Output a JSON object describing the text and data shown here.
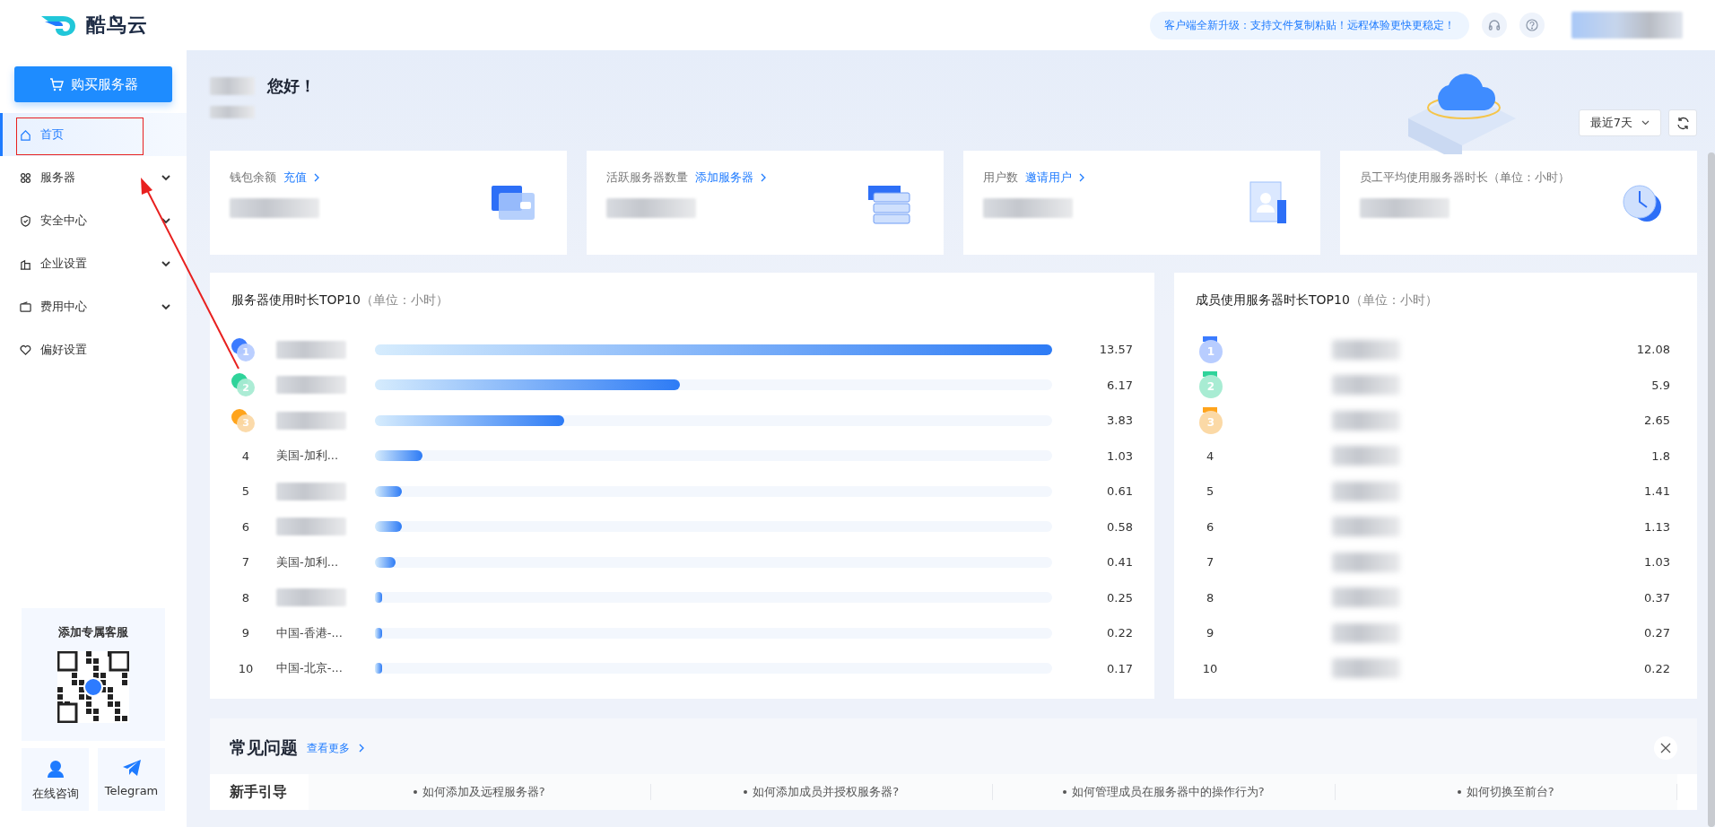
{
  "brand": {
    "name": "酷鸟云"
  },
  "buy_button": "购买服务器",
  "sidebar": {
    "items": [
      {
        "label": "首页",
        "selected": true,
        "expandable": false
      },
      {
        "label": "服务器",
        "selected": false,
        "expandable": true
      },
      {
        "label": "安全中心",
        "selected": false,
        "expandable": true
      },
      {
        "label": "企业设置",
        "selected": false,
        "expandable": true
      },
      {
        "label": "费用中心",
        "selected": false,
        "expandable": true
      },
      {
        "label": "偏好设置",
        "selected": false,
        "expandable": false
      }
    ]
  },
  "support": {
    "title": "添加专属客服",
    "links": [
      {
        "label": "在线咨询"
      },
      {
        "label": "Telegram"
      }
    ]
  },
  "header": {
    "notice": "客户端全新升级：支持文件复制粘贴！远程体验更快更稳定！"
  },
  "greeting": "您好！",
  "range": {
    "value": "最近7天"
  },
  "stats": [
    {
      "label": "钱包余额",
      "link": "充值"
    },
    {
      "label": "活跃服务器数量",
      "link": "添加服务器"
    },
    {
      "label": "用户数",
      "link": "邀请用户"
    },
    {
      "label": "员工平均使用服务器时长（单位：小时）"
    }
  ],
  "server_top": {
    "title": "服务器使用时长TOP10",
    "unit": "（单位：小时）",
    "rows": [
      {
        "rank": "1",
        "value": "13.57",
        "level": 1.0
      },
      {
        "rank": "2",
        "value": "6.17",
        "level": 0.45
      },
      {
        "rank": "3",
        "value": "3.83",
        "level": 0.28
      },
      {
        "rank": "4",
        "name": "美国-加利...",
        "value": "1.03",
        "level": 0.07
      },
      {
        "rank": "5",
        "value": "0.61",
        "level": 0.04
      },
      {
        "rank": "6",
        "value": "0.58",
        "level": 0.04
      },
      {
        "rank": "7",
        "name": "美国-加利...",
        "value": "0.41",
        "level": 0.03
      },
      {
        "rank": "8",
        "value": "0.25",
        "level": 0.01
      },
      {
        "rank": "9",
        "name": "中国-香港-...",
        "value": "0.22",
        "level": 0.01
      },
      {
        "rank": "10",
        "name": "中国-北京-...",
        "value": "0.17",
        "level": 0.01
      }
    ]
  },
  "member_top": {
    "title": "成员使用服务器时长TOP10",
    "unit": "（单位：小时）",
    "rows": [
      {
        "rank": "1",
        "value": "12.08"
      },
      {
        "rank": "2",
        "value": "5.9"
      },
      {
        "rank": "3",
        "value": "2.65"
      },
      {
        "rank": "4",
        "value": "1.8"
      },
      {
        "rank": "5",
        "value": "1.41"
      },
      {
        "rank": "6",
        "value": "1.13"
      },
      {
        "rank": "7",
        "value": "1.03"
      },
      {
        "rank": "8",
        "value": "0.37"
      },
      {
        "rank": "9",
        "value": "0.27"
      },
      {
        "rank": "10",
        "value": "0.22"
      }
    ]
  },
  "faq": {
    "title": "常见问题",
    "more": "查看更多",
    "guide": "新手引导",
    "questions": [
      "如何添加及远程服务器?",
      "如何添加成员并授权服务器?",
      "如何管理成员在服务器中的操作行为?",
      "如何切换至前台?"
    ]
  }
}
